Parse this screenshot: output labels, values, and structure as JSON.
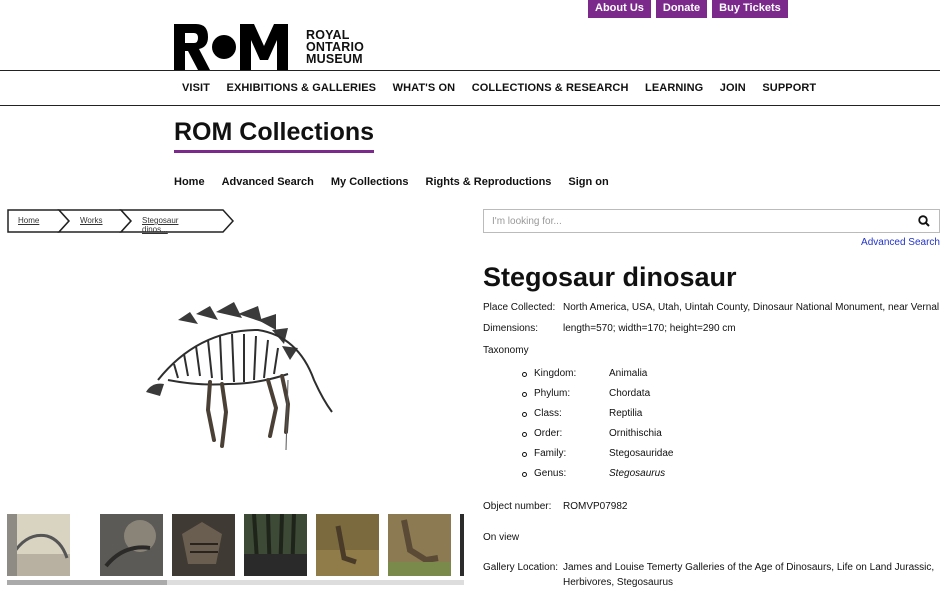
{
  "utility_links": [
    "About Us",
    "Donate",
    "Buy Tickets"
  ],
  "logo": {
    "mark": "ROM",
    "lines": [
      "ROYAL",
      "ONTARIO",
      "MUSEUM"
    ]
  },
  "main_nav": [
    "VISIT",
    "EXHIBITIONS & GALLERIES",
    "WHAT'S ON",
    "COLLECTIONS & RESEARCH",
    "LEARNING",
    "JOIN",
    "SUPPORT"
  ],
  "collections_title": "ROM Collections",
  "sub_nav": [
    "Home",
    "Advanced Search",
    "My Collections",
    "Rights & Reproductions",
    "Sign on"
  ],
  "breadcrumb": [
    "Home",
    "Works",
    "Stegosaur dinos..."
  ],
  "search": {
    "placeholder": "I'm looking for...",
    "advanced_link": "Advanced Search"
  },
  "object": {
    "title": "Stegosaur dinosaur",
    "place_label": "Place Collected:",
    "place_value": "North America, USA, Utah, Uintah County, Dinosaur National Monument, near Vernal",
    "dimensions_label": "Dimensions:",
    "dimensions_value": "length=570; width=170; height=290 cm",
    "taxonomy_label": "Taxonomy",
    "taxonomy": [
      {
        "label": "Kingdom:",
        "value": "Animalia"
      },
      {
        "label": "Phylum:",
        "value": "Chordata"
      },
      {
        "label": "Class:",
        "value": "Reptilia"
      },
      {
        "label": "Order:",
        "value": "Ornithischia"
      },
      {
        "label": "Family:",
        "value": "Stegosauridae"
      },
      {
        "label": "Genus:",
        "value": "Stegosaurus"
      }
    ],
    "object_number_label": "Object number:",
    "object_number_value": "ROMVP07982",
    "on_view": "On view",
    "gallery_label": "Gallery Location:",
    "gallery_value": "James and Louise Temerty Galleries of the Age of Dinosaurs, Life on Land Jurassic, Herbivores, Stegosaurus"
  },
  "colors": {
    "accent": "#7b2a8c",
    "link": "#2233cc"
  }
}
